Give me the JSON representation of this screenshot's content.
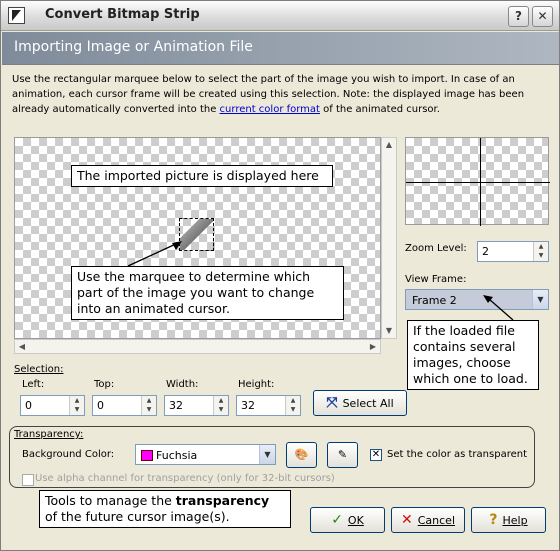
{
  "window": {
    "title": "Convert Bitmap Strip",
    "buttons": {
      "help": "?",
      "close": "✕"
    }
  },
  "header": {
    "title": "Importing Image or Animation File"
  },
  "description": {
    "text_before": "Use the rectangular marquee below to select the part of the image you wish to import. In case of an animation, each cursor frame will be created using this selection. Note: the displayed image has been already automatically converted into the ",
    "link": "current color format",
    "text_after": " of the animated cursor."
  },
  "callouts": {
    "picture": "The imported picture is displayed here",
    "marquee": "Use the marquee to determine which part of the image you want to change into an animated cursor.",
    "frames": "If the loaded file contains several images, choose which one to load.",
    "transparency_prefix": "Tools to manage the ",
    "transparency_bold": "transparency",
    "transparency_suffix": " of the future cursor image(s)."
  },
  "zoom": {
    "label": "Zoom Level:",
    "value": "2"
  },
  "view_frame": {
    "label": "View Frame:",
    "value": "Frame 2"
  },
  "selection": {
    "label": "Selection:",
    "left_label": "Left:",
    "left": "0",
    "top_label": "Top:",
    "top": "0",
    "width_label": "Width:",
    "width": "32",
    "height_label": "Height:",
    "height": "32",
    "select_all": "Select All"
  },
  "transparency": {
    "label": "Transparency:",
    "bg_label": "Background Color:",
    "bg_value": "Fuchsia",
    "bg_color": "#ff00ff",
    "set_transparent": "Set the color as transparent",
    "set_transparent_checked": true,
    "alpha": "Use alpha channel for transparency (only for 32-bit cursors)"
  },
  "actions": {
    "ok": "OK",
    "cancel": "Cancel",
    "help": "Help"
  },
  "colors": {
    "header_start": "#7f8b9a",
    "link": "#0000cc"
  }
}
